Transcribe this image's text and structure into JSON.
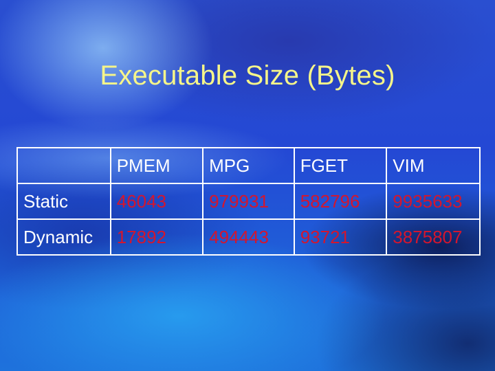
{
  "slide": {
    "title": "Executable Size (Bytes)"
  },
  "table": {
    "corner": "",
    "columns": [
      "PMEM",
      "MPG",
      "FGET",
      "VIM"
    ],
    "rows": [
      {
        "label": "Static",
        "values": [
          "46043",
          "979931",
          "582796",
          "9935633"
        ]
      },
      {
        "label": "Dynamic",
        "values": [
          "17892",
          "494443",
          "93721",
          "3875807"
        ]
      }
    ]
  },
  "colors": {
    "title": "#f5f58a",
    "header_text": "#ffffff",
    "value_text": "#d4162e",
    "grid": "#ffffff"
  }
}
